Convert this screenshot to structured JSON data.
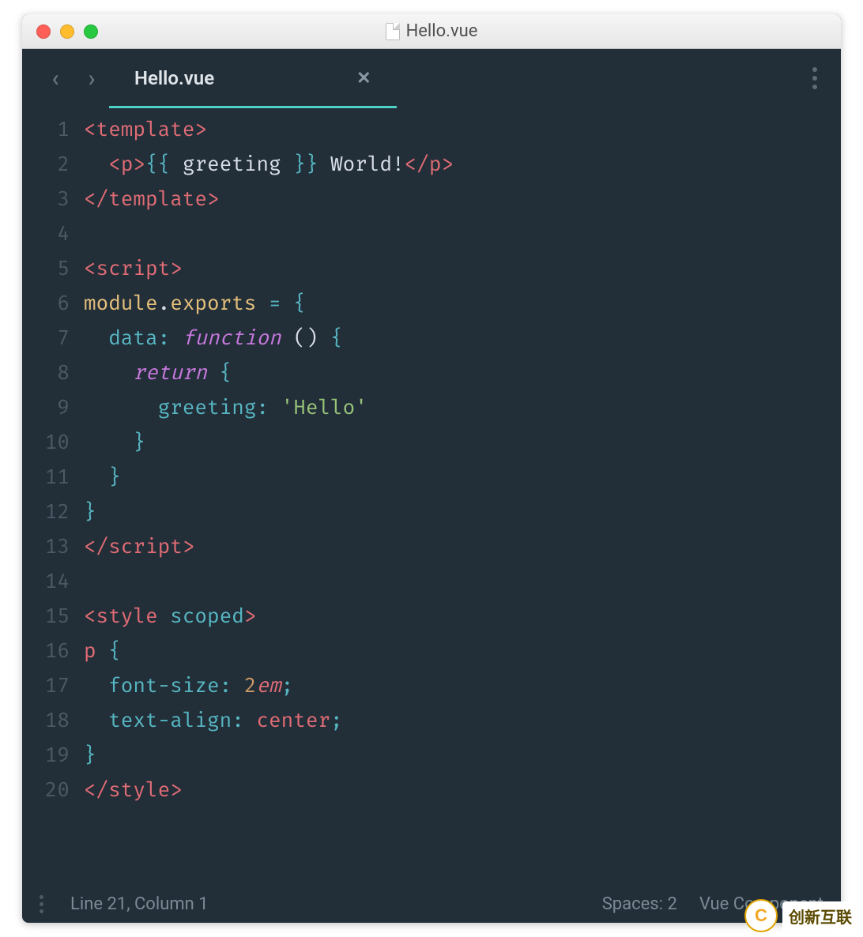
{
  "window": {
    "title": "Hello.vue"
  },
  "tabs": {
    "back_enabled": false,
    "forward_enabled": false,
    "active_tab_label": "Hello.vue"
  },
  "code": {
    "lines": [
      {
        "n": 1,
        "tokens": [
          [
            "<",
            "p-ang"
          ],
          [
            "template",
            "p-tag"
          ],
          [
            ">",
            "p-ang"
          ]
        ]
      },
      {
        "n": 2,
        "tokens": [
          [
            "  ",
            "p-plain"
          ],
          [
            "<",
            "p-ang"
          ],
          [
            "p",
            "p-tag"
          ],
          [
            ">",
            "p-ang"
          ],
          [
            "{{ ",
            "p-attr"
          ],
          [
            "greeting",
            "p-plain"
          ],
          [
            " }}",
            "p-attr"
          ],
          [
            " World!",
            "p-plain"
          ],
          [
            "</",
            "p-ang"
          ],
          [
            "p",
            "p-tag"
          ],
          [
            ">",
            "p-ang"
          ]
        ]
      },
      {
        "n": 3,
        "tokens": [
          [
            "</",
            "p-ang"
          ],
          [
            "template",
            "p-tag"
          ],
          [
            ">",
            "p-ang"
          ]
        ]
      },
      {
        "n": 4,
        "tokens": [
          [
            "",
            "p-plain"
          ]
        ]
      },
      {
        "n": 5,
        "tokens": [
          [
            "<",
            "p-ang"
          ],
          [
            "script",
            "p-tag"
          ],
          [
            ">",
            "p-ang"
          ]
        ]
      },
      {
        "n": 6,
        "tokens": [
          [
            "module",
            "p-ident"
          ],
          [
            ".",
            "p-plain"
          ],
          [
            "exports",
            "p-ident"
          ],
          [
            " ",
            "p-plain"
          ],
          [
            "=",
            "p-op"
          ],
          [
            " ",
            "p-plain"
          ],
          [
            "{",
            "p-attr"
          ]
        ]
      },
      {
        "n": 7,
        "tokens": [
          [
            "  ",
            "p-plain"
          ],
          [
            "data",
            "p-prop"
          ],
          [
            ":",
            "p-op"
          ],
          [
            " ",
            "p-plain"
          ],
          [
            "function",
            "p-fn"
          ],
          [
            " ",
            "p-plain"
          ],
          [
            "()",
            "p-plain"
          ],
          [
            " ",
            "p-plain"
          ],
          [
            "{",
            "p-attr"
          ]
        ]
      },
      {
        "n": 8,
        "tokens": [
          [
            "    ",
            "p-plain"
          ],
          [
            "return",
            "p-key ital"
          ],
          [
            " ",
            "p-plain"
          ],
          [
            "{",
            "p-attr"
          ]
        ]
      },
      {
        "n": 9,
        "tokens": [
          [
            "      ",
            "p-plain"
          ],
          [
            "greeting",
            "p-prop"
          ],
          [
            ":",
            "p-op"
          ],
          [
            " ",
            "p-plain"
          ],
          [
            "'Hello'",
            "p-str"
          ]
        ]
      },
      {
        "n": 10,
        "tokens": [
          [
            "    ",
            "p-plain"
          ],
          [
            "}",
            "p-attr"
          ]
        ]
      },
      {
        "n": 11,
        "tokens": [
          [
            "  ",
            "p-plain"
          ],
          [
            "}",
            "p-attr"
          ]
        ]
      },
      {
        "n": 12,
        "tokens": [
          [
            "}",
            "p-attr"
          ]
        ]
      },
      {
        "n": 13,
        "tokens": [
          [
            "</",
            "p-ang"
          ],
          [
            "script",
            "p-tag"
          ],
          [
            ">",
            "p-ang"
          ]
        ]
      },
      {
        "n": 14,
        "tokens": [
          [
            "",
            "p-plain"
          ]
        ]
      },
      {
        "n": 15,
        "tokens": [
          [
            "<",
            "p-ang"
          ],
          [
            "style",
            "p-tag"
          ],
          [
            " ",
            "p-plain"
          ],
          [
            "scoped",
            "p-attr"
          ],
          [
            ">",
            "p-ang"
          ]
        ]
      },
      {
        "n": 16,
        "tokens": [
          [
            "p ",
            "p-tag"
          ],
          [
            "{",
            "p-attr"
          ]
        ]
      },
      {
        "n": 17,
        "tokens": [
          [
            "  ",
            "p-plain"
          ],
          [
            "font-size",
            "p-prop"
          ],
          [
            ":",
            "p-op"
          ],
          [
            " ",
            "p-plain"
          ],
          [
            "2",
            "p-num"
          ],
          [
            "em",
            "p-unit"
          ],
          [
            ";",
            "p-op"
          ]
        ]
      },
      {
        "n": 18,
        "tokens": [
          [
            "  ",
            "p-plain"
          ],
          [
            "text-align",
            "p-prop"
          ],
          [
            ":",
            "p-op"
          ],
          [
            " ",
            "p-plain"
          ],
          [
            "center",
            "p-tag"
          ],
          [
            ";",
            "p-op"
          ]
        ]
      },
      {
        "n": 19,
        "tokens": [
          [
            "}",
            "p-attr"
          ]
        ]
      },
      {
        "n": 20,
        "tokens": [
          [
            "</",
            "p-ang"
          ],
          [
            "style",
            "p-tag"
          ],
          [
            ">",
            "p-ang"
          ]
        ]
      }
    ]
  },
  "status": {
    "cursor": "Line 21, Column 1",
    "indent": "Spaces: 2",
    "syntax": "Vue Component"
  },
  "watermark": {
    "logo_letter": "C",
    "text": "创新互联"
  }
}
